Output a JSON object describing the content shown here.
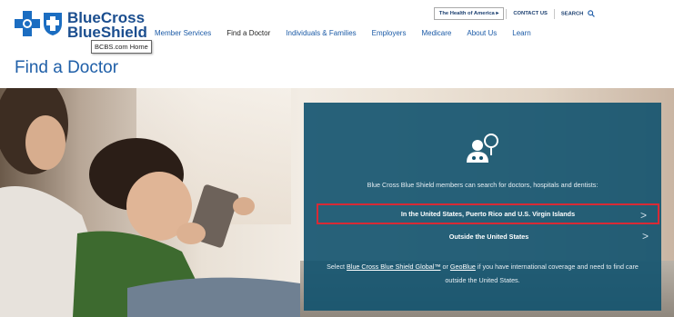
{
  "brand": {
    "logo_line1": "BlueCross",
    "logo_line2": "BlueShield",
    "tooltip": "BCBS.com Home",
    "colors": {
      "primary": "#1b4e8f",
      "panel": "#11526e",
      "highlight": "#d92a35"
    }
  },
  "utility": {
    "health_link": "The Health of America ▸",
    "contact": "CONTACT US",
    "search": "SEARCH",
    "search_icon": "magnifier-icon"
  },
  "nav": {
    "items": [
      {
        "label": "Member Services"
      },
      {
        "label": "Find a Doctor",
        "active": true
      },
      {
        "label": "Individuals & Families"
      },
      {
        "label": "Employers"
      },
      {
        "label": "Medicare"
      },
      {
        "label": "About Us"
      },
      {
        "label": "Learn"
      }
    ]
  },
  "page": {
    "title": "Find a Doctor"
  },
  "panel": {
    "icon": "doctor-location-icon",
    "intro": "Blue Cross Blue Shield members can search for doctors, hospitals and dentists:",
    "options": [
      {
        "label": "In the United States, Puerto Rico and U.S. Virgin Islands",
        "chevron": ">"
      },
      {
        "label": "Outside the United States",
        "chevron": ">"
      }
    ],
    "footer": {
      "pre": "Select ",
      "link1": "Blue Cross Blue Shield Global™",
      "mid": " or ",
      "link2": "GeoBlue",
      "post": " if you have international coverage and need to find care outside the United States."
    }
  }
}
